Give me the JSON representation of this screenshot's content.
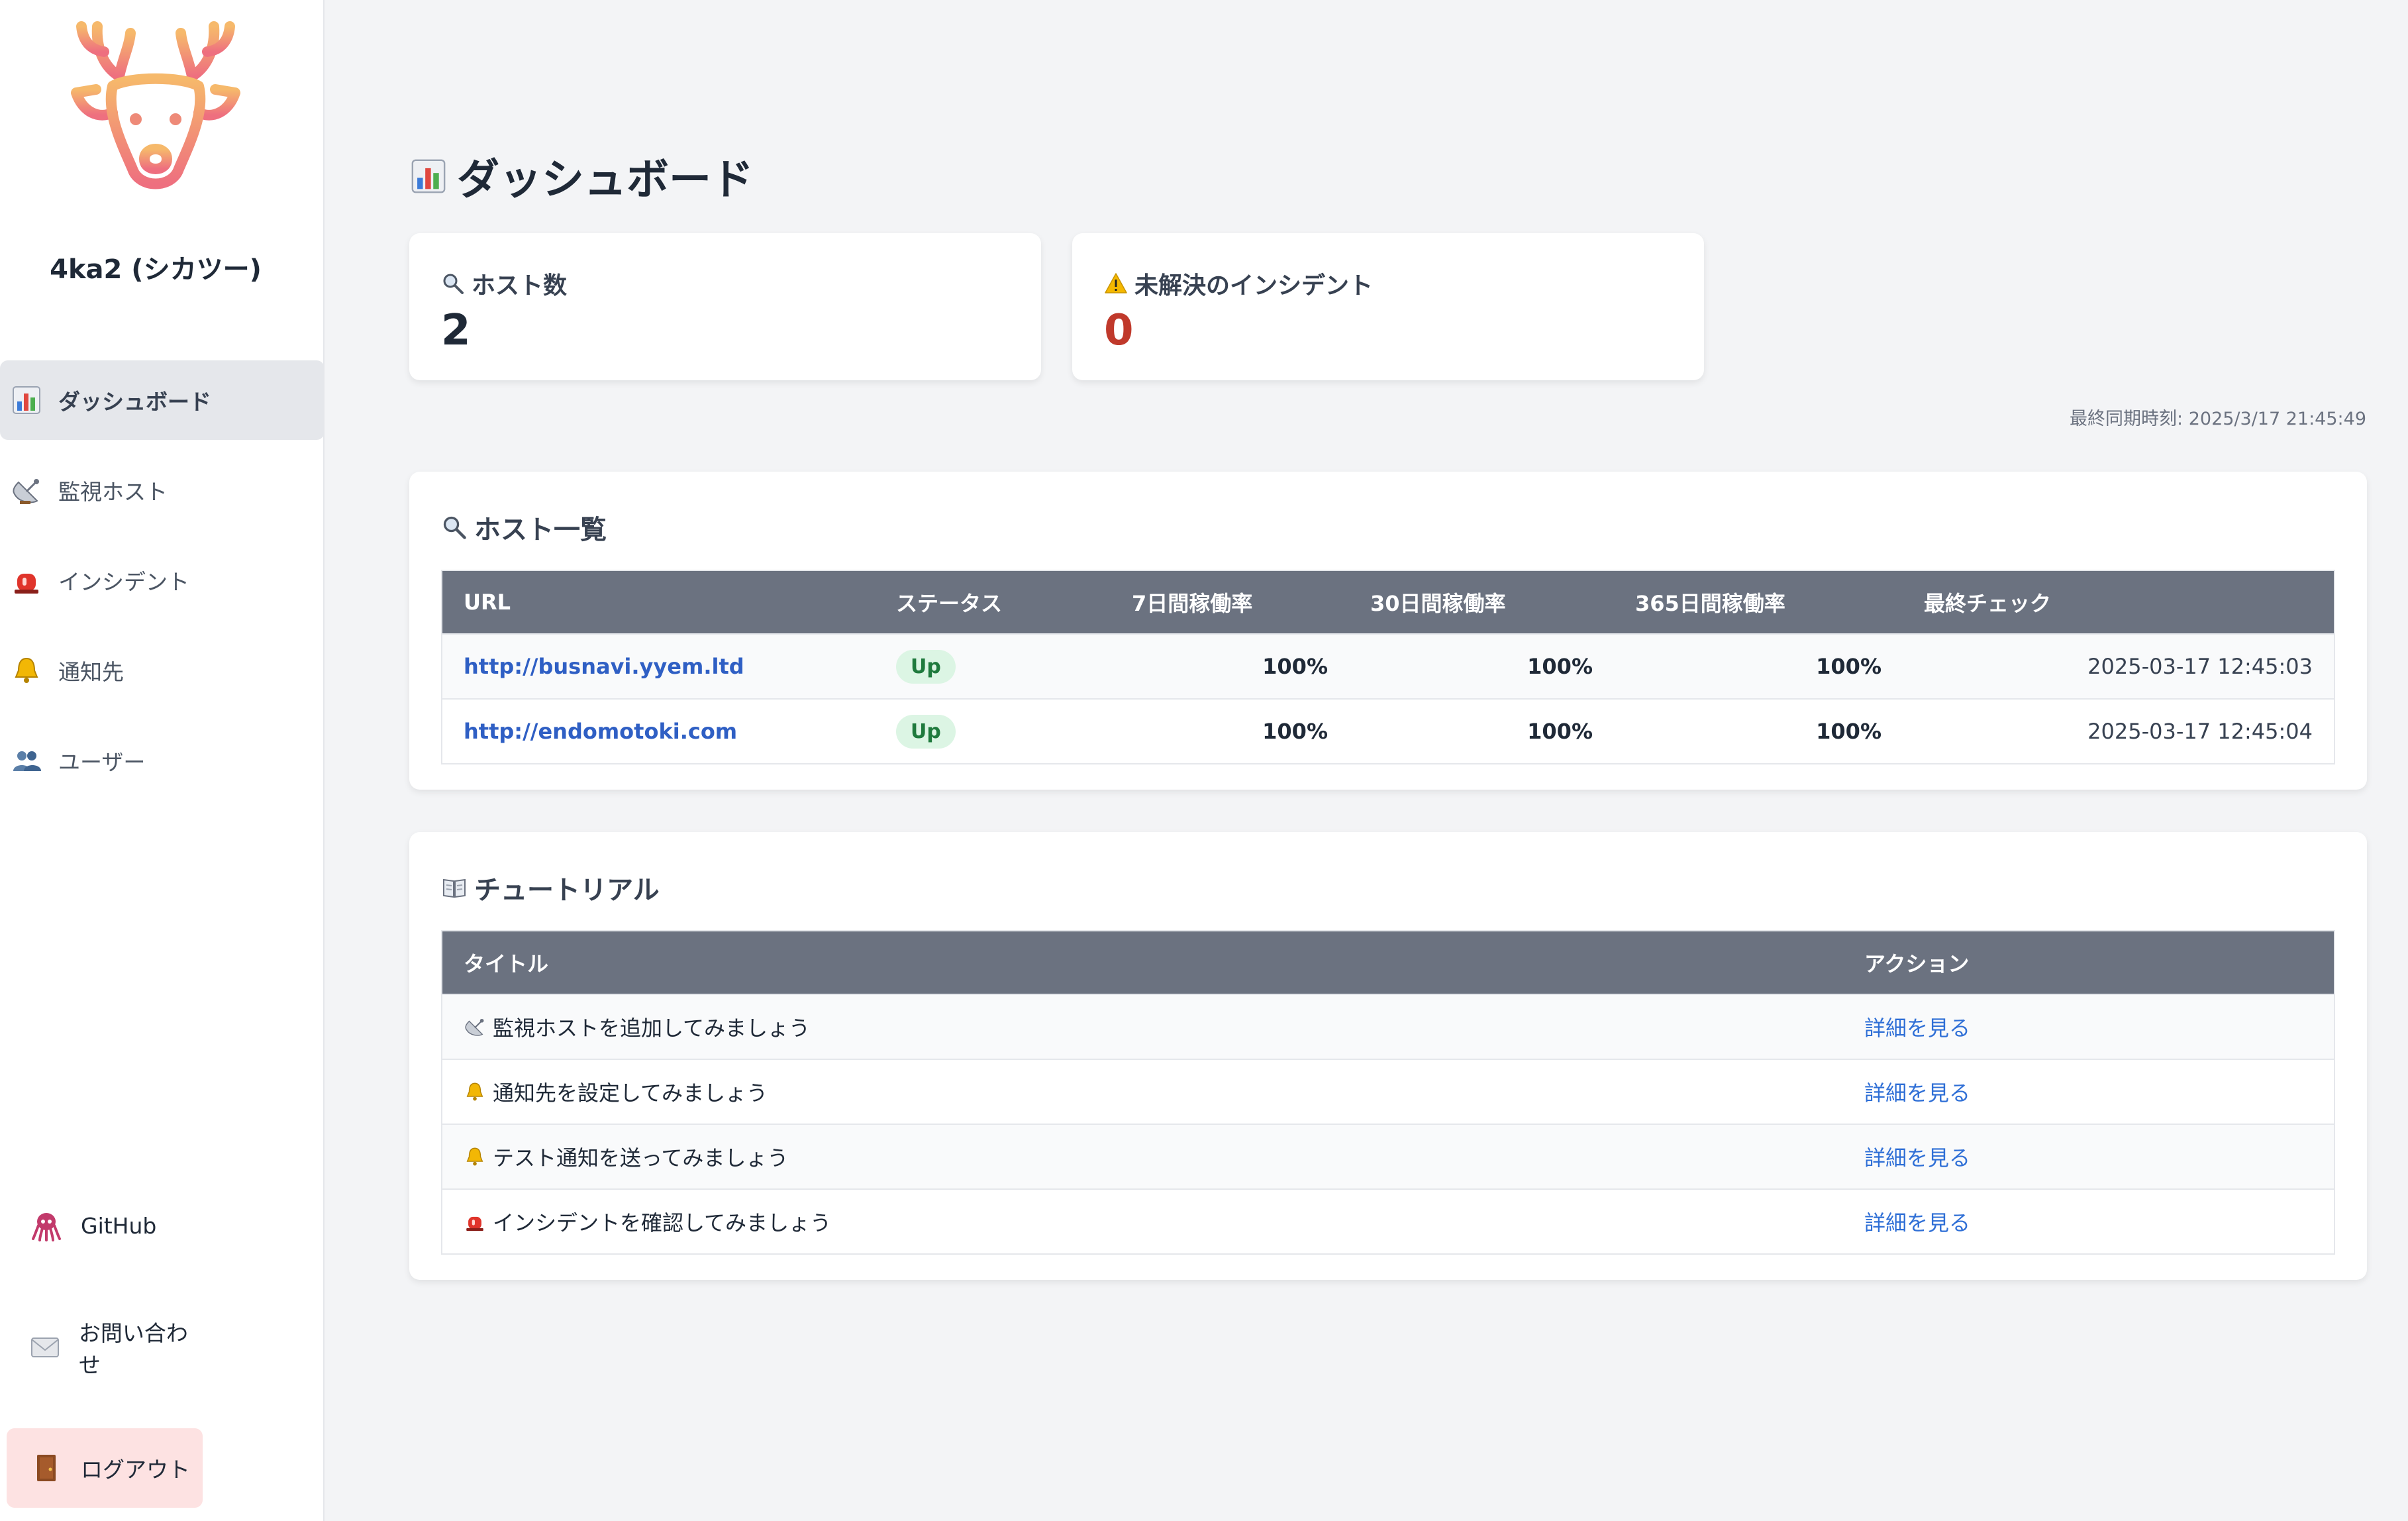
{
  "sidebar": {
    "brand": "4ka2 (シカツー)",
    "nav": [
      {
        "label": "ダッシュボード",
        "icon": "chart-icon",
        "active": true
      },
      {
        "label": "監視ホスト",
        "icon": "satellite-icon",
        "active": false
      },
      {
        "label": "インシデント",
        "icon": "siren-icon",
        "active": false
      },
      {
        "label": "通知先",
        "icon": "bell-icon",
        "active": false
      },
      {
        "label": "ユーザー",
        "icon": "users-icon",
        "active": false
      }
    ],
    "github": "GitHub",
    "contact": "お問い合わせ",
    "logout": "ログアウト"
  },
  "main": {
    "title": "ダッシュボード",
    "stats": {
      "hosts_label": "ホスト数",
      "hosts_value": "2",
      "incidents_label": "未解決のインシデント",
      "incidents_value": "0"
    },
    "last_sync": "最終同期時刻: 2025/3/17 21:45:49",
    "hosts_panel": {
      "title": "ホスト一覧",
      "headers": [
        "URL",
        "ステータス",
        "7日間稼働率",
        "30日間稼働率",
        "365日間稼働率",
        "最終チェック"
      ],
      "rows": [
        {
          "url": "http://busnavi.yyem.ltd",
          "status": "Up",
          "d7": "100%",
          "d30": "100%",
          "d365": "100%",
          "last": "2025-03-17 12:45:03"
        },
        {
          "url": "http://endomotoki.com",
          "status": "Up",
          "d7": "100%",
          "d30": "100%",
          "d365": "100%",
          "last": "2025-03-17 12:45:04"
        }
      ]
    },
    "tutorial_panel": {
      "title": "チュートリアル",
      "headers": [
        "タイトル",
        "アクション"
      ],
      "rows": [
        {
          "title": "監視ホストを追加してみましょう",
          "icon": "satellite-icon",
          "action": "詳細を見る"
        },
        {
          "title": "通知先を設定してみましょう",
          "icon": "bell-icon",
          "action": "詳細を見る"
        },
        {
          "title": "テスト通知を送ってみましょう",
          "icon": "bell-icon",
          "action": "詳細を見る"
        },
        {
          "title": "インシデントを確認してみましょう",
          "icon": "siren-icon",
          "action": "詳細を見る"
        }
      ]
    }
  },
  "colors": {
    "accent_logo_top": "#f6b96b",
    "accent_logo_bottom": "#ee6f7f",
    "table_header": "#6b7280",
    "incident_red": "#c0392b",
    "link_blue": "#2f5fc4",
    "badge_bg": "#dcf5e4",
    "logout_bg": "#fde2e2"
  }
}
